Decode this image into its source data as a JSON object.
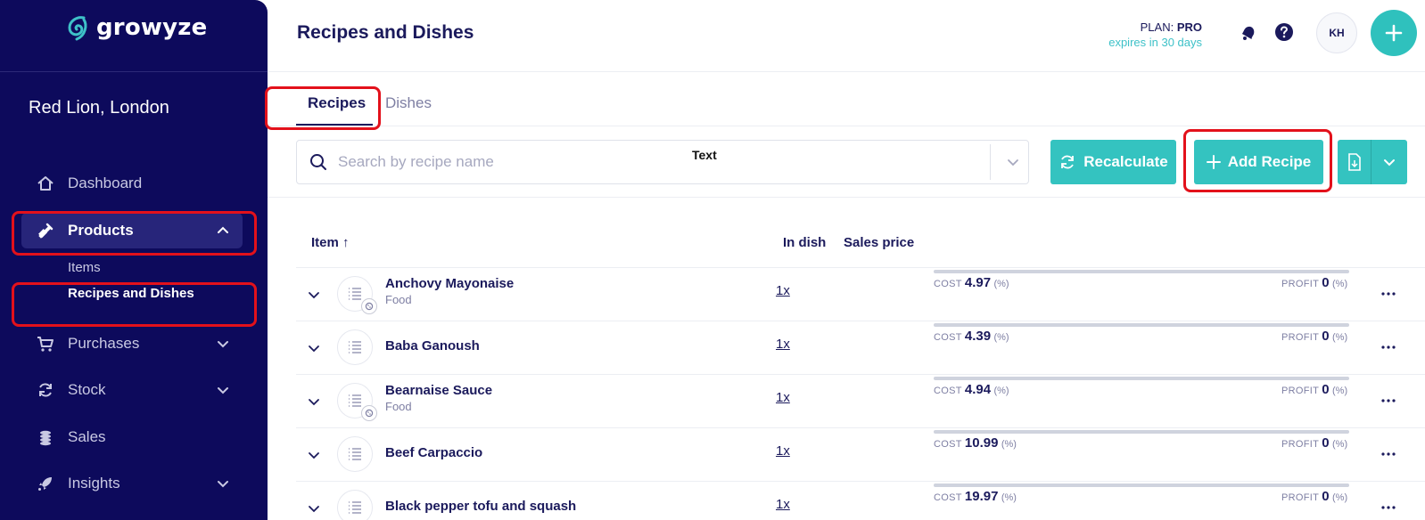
{
  "app": {
    "brand": "growyze",
    "venue": "Red Lion, London"
  },
  "sidebar": {
    "items": [
      {
        "label": "Dashboard",
        "icon": "home-icon"
      },
      {
        "label": "Products",
        "icon": "bottle-icon"
      },
      {
        "label": "Purchases",
        "icon": "cart-icon"
      },
      {
        "label": "Stock",
        "icon": "refresh-icon"
      },
      {
        "label": "Sales",
        "icon": "coins-icon"
      },
      {
        "label": "Insights",
        "icon": "rocket-icon"
      }
    ],
    "products_sub": [
      "Items",
      "Recipes and Dishes"
    ]
  },
  "header": {
    "title": "Recipes and Dishes",
    "plan_prefix": "PLAN: ",
    "plan_name": "PRO",
    "expires": "expires in 30 days",
    "avatar_initials": "KH"
  },
  "tabs": [
    "Recipes",
    "Dishes"
  ],
  "toolbar": {
    "search_placeholder": "Search by recipe name",
    "text_tag": "Text",
    "recalculate_label": "Recalculate",
    "add_recipe_label": "Add Recipe"
  },
  "table": {
    "columns": {
      "item": "Item ↑",
      "in_dish": "In dish",
      "sales_price": "Sales price"
    },
    "cost_label": "COST",
    "profit_label": "PROFIT",
    "pct_label": "(%)",
    "rows": [
      {
        "name": "Anchovy Mayonaise",
        "category": "Food",
        "in_dish": "1x",
        "cost": "4.97",
        "profit": "0"
      },
      {
        "name": "Baba Ganoush",
        "category": "",
        "in_dish": "1x",
        "cost": "4.39",
        "profit": "0"
      },
      {
        "name": "Bearnaise Sauce",
        "category": "Food",
        "in_dish": "1x",
        "cost": "4.94",
        "profit": "0"
      },
      {
        "name": "Beef Carpaccio",
        "category": "",
        "in_dish": "1x",
        "cost": "10.99",
        "profit": "0"
      },
      {
        "name": "Black pepper tofu and squash",
        "category": "",
        "in_dish": "1x",
        "cost": "19.97",
        "profit": "0"
      }
    ]
  },
  "colors": {
    "sidebar_bg": "#0d0a5c",
    "accent_teal": "#34c3c0",
    "annotation_red": "#e3111b",
    "text_navy": "#1b1a5c"
  }
}
